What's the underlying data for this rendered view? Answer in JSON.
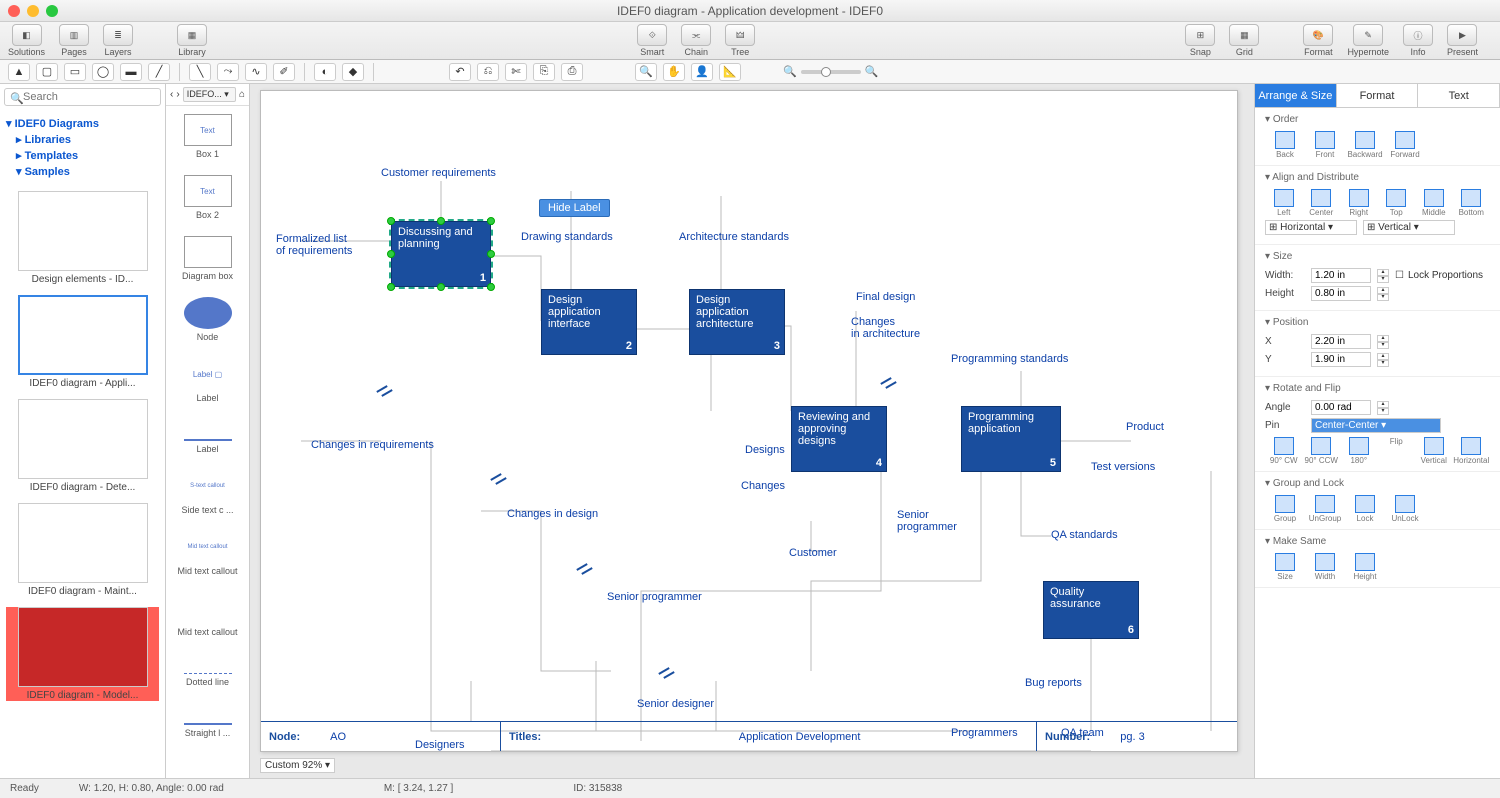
{
  "window": {
    "title": "IDEF0 diagram - Application development - IDEF0"
  },
  "toolbar": {
    "left": [
      {
        "label": "Solutions"
      },
      {
        "label": "Pages"
      },
      {
        "label": "Layers"
      },
      {
        "label": "Library"
      }
    ],
    "center": [
      {
        "label": "Smart"
      },
      {
        "label": "Chain"
      },
      {
        "label": "Tree"
      }
    ],
    "right": [
      {
        "label": "Snap"
      },
      {
        "label": "Grid"
      },
      {
        "label": "Format"
      },
      {
        "label": "Hypernote"
      },
      {
        "label": "Info"
      },
      {
        "label": "Present"
      }
    ]
  },
  "left_panel": {
    "search_placeholder": "Search",
    "tree_root": "IDEF0 Diagrams",
    "tree_items": [
      "Libraries",
      "Templates",
      "Samples"
    ],
    "thumbs": [
      {
        "label": "Design elements - ID..."
      },
      {
        "label": "IDEF0 diagram - Appli..."
      },
      {
        "label": "IDEF0 diagram - Dete..."
      },
      {
        "label": "IDEF0 diagram - Maint..."
      },
      {
        "label": "IDEF0 diagram - Model..."
      }
    ]
  },
  "shapes": {
    "dropdown": "IDEFO...",
    "items": [
      "Box 1",
      "Box 2",
      "Diagram box",
      "Node",
      "Label",
      "Label",
      "Side text c ...",
      "Mid text callout",
      "Mid text callout",
      "Dotted line",
      "Straight l ..."
    ]
  },
  "diagram": {
    "tooltip": "Hide Label",
    "labels": {
      "customer_req": "Customer requirements",
      "formalized": "Formalized list\nof requirements",
      "drawing_std": "Drawing standards",
      "arch_std": "Architecture standards",
      "final_design": "Final design",
      "changes_arch": "Changes\nin architecture",
      "prog_std": "Programming standards",
      "product": "Product",
      "test_ver": "Test versions",
      "changes_req": "Changes in requirements",
      "changes_des": "Changes in design",
      "designs": "Designs",
      "changes": "Changes",
      "customer": "Customer",
      "senior_prog": "Senior\nprogrammer",
      "qa_std": "QA standards",
      "senior_prog2": "Senior programmer",
      "senior_des": "Senior designer",
      "bug_rep": "Bug reports",
      "designers": "Designers",
      "programmers": "Programmers",
      "qa_team": "QA team"
    },
    "boxes": {
      "b1": {
        "title": "Discussing and planning",
        "num": "1"
      },
      "b2": {
        "title": "Design application interface",
        "num": "2"
      },
      "b3": {
        "title": "Design application architecture",
        "num": "3"
      },
      "b4": {
        "title": "Reviewing and approving designs",
        "num": "4"
      },
      "b5": {
        "title": "Programming application",
        "num": "5"
      },
      "b6": {
        "title": "Quality assurance",
        "num": "6"
      }
    },
    "footer": {
      "node_lbl": "Node:",
      "node_val": "AO",
      "titles_lbl": "Titles:",
      "titles_val": "Application Development",
      "number_lbl": "Number:",
      "number_val": "pg. 3"
    }
  },
  "zoom": {
    "label": "Custom 92%"
  },
  "right_panel": {
    "tabs": [
      "Arrange & Size",
      "Format",
      "Text"
    ],
    "sections": {
      "order": {
        "title": "Order",
        "items": [
          "Back",
          "Front",
          "Backward",
          "Forward"
        ]
      },
      "align": {
        "title": "Align and Distribute",
        "row1": [
          "Left",
          "Center",
          "Right",
          "Top",
          "Middle",
          "Bottom"
        ],
        "dd1": "Horizontal",
        "dd2": "Vertical"
      },
      "size": {
        "title": "Size",
        "width_lbl": "Width:",
        "width_val": "1.20 in",
        "height_lbl": "Height",
        "height_val": "0.80 in",
        "lock": "Lock Proportions"
      },
      "position": {
        "title": "Position",
        "x_lbl": "X",
        "x_val": "2.20 in",
        "y_lbl": "Y",
        "y_val": "1.90 in"
      },
      "rotate": {
        "title": "Rotate and Flip",
        "angle_lbl": "Angle",
        "angle_val": "0.00 rad",
        "pin_lbl": "Pin",
        "pin_val": "Center-Center",
        "row": [
          "90° CW",
          "90° CCW",
          "180°"
        ],
        "flip_lbl": "Flip",
        "flip": [
          "Vertical",
          "Horizontal"
        ]
      },
      "group": {
        "title": "Group and Lock",
        "items": [
          "Group",
          "UnGroup",
          "Lock",
          "UnLock"
        ]
      },
      "make_same": {
        "title": "Make Same",
        "items": [
          "Size",
          "Width",
          "Height"
        ]
      }
    }
  },
  "status": {
    "ready": "Ready",
    "size": "W: 1.20,  H: 0.80,  Angle: 0.00 rad",
    "mouse": "M: [ 3.24, 1.27 ]",
    "id": "ID: 315838"
  }
}
